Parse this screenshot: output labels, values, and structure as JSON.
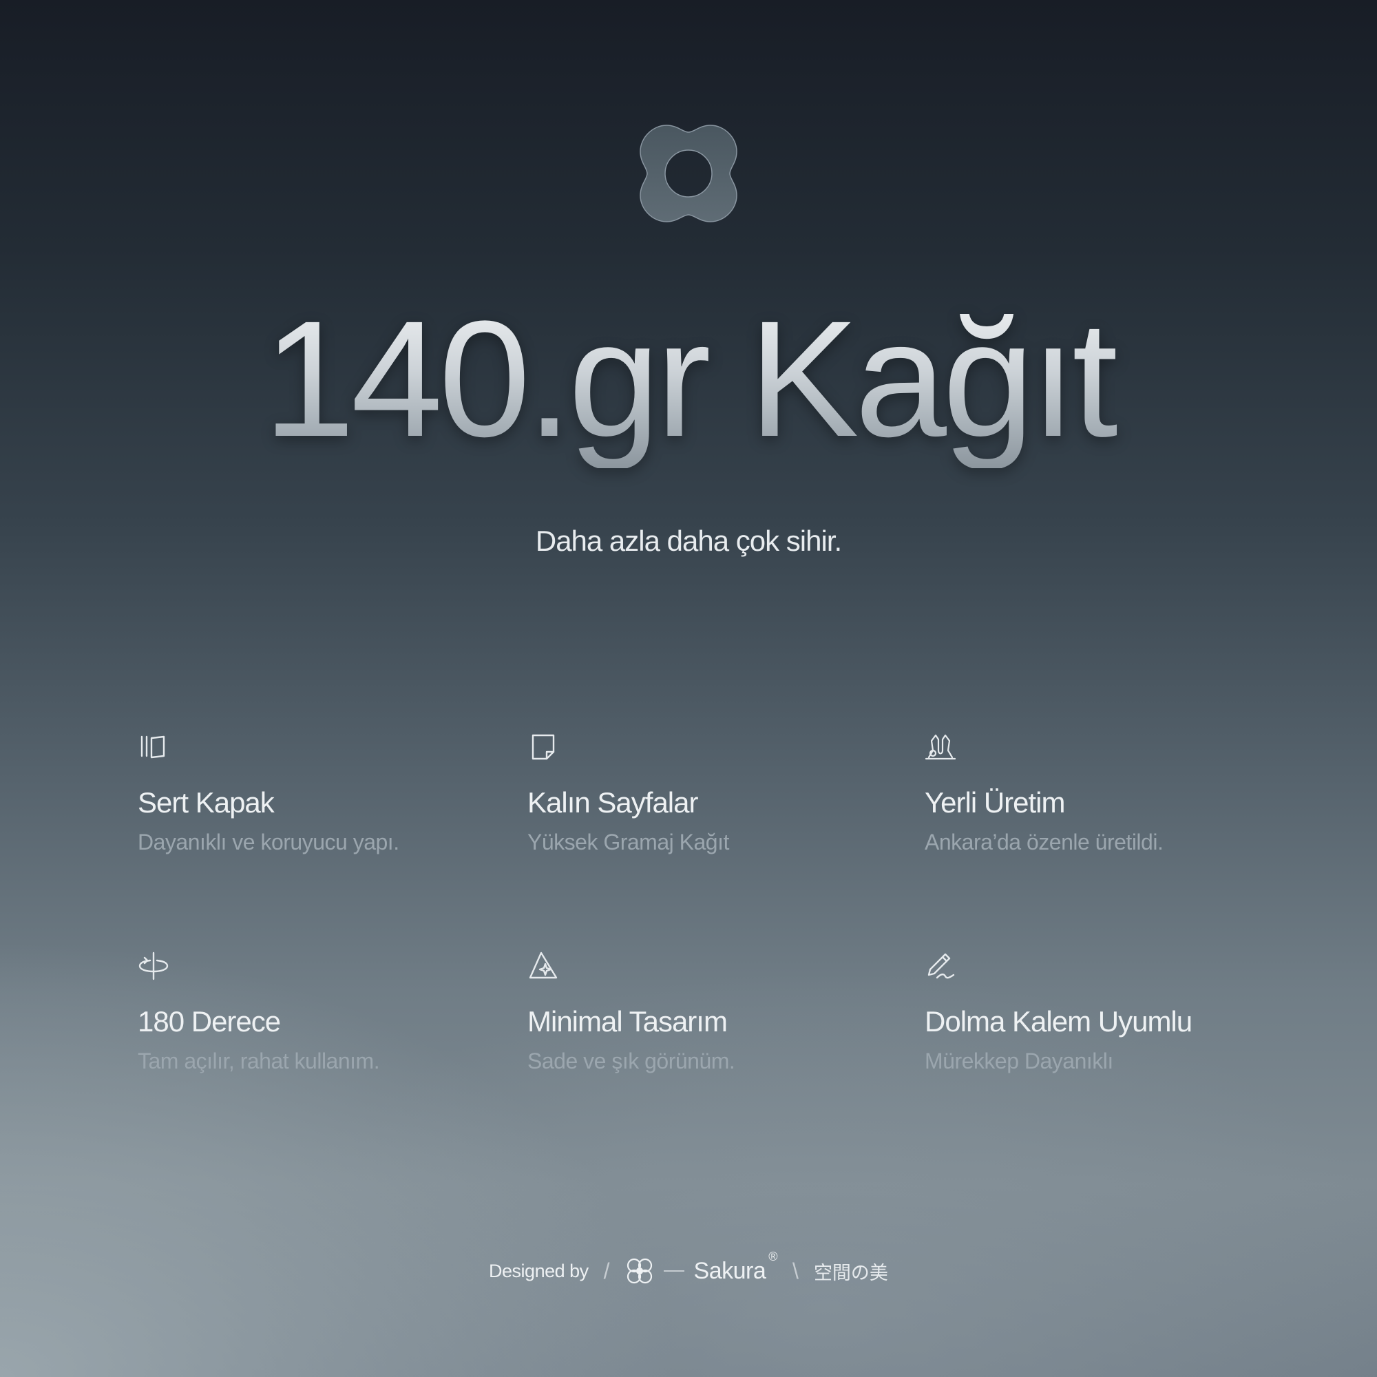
{
  "hero": {
    "logo_icon": "sakura-glass-logo-icon",
    "headline": "140.gr Kağıt",
    "tagline": "Daha azla daha çok sihir."
  },
  "features": [
    {
      "icon": "book-cover-icon",
      "title": "Sert Kapak",
      "description": "Dayanıklı ve koruyucu yapı."
    },
    {
      "icon": "page-icon",
      "title": "Kalın Sayfalar",
      "description": "Yüksek Gramaj Kağıt"
    },
    {
      "icon": "hands-icon",
      "title": "Yerli Üretim",
      "description": "Ankara’da özenle üretildi."
    },
    {
      "icon": "rotate-180-icon",
      "title": "180 Derece",
      "description": "Tam açılır, rahat kullanım."
    },
    {
      "icon": "sparkle-shape-icon",
      "title": "Minimal Tasarım",
      "description": "Sade ve şık görünüm."
    },
    {
      "icon": "pen-icon",
      "title": "Dolma Kalem Uyumlu",
      "description": "Mürekkep Dayanıklı"
    }
  ],
  "footer": {
    "designed_by": "Designed by",
    "separator_left": "/",
    "separator_right": "\\",
    "brand_icon": "sakura-flower-icon",
    "brand": "Sakura",
    "registered": "®",
    "japanese": "空間の美"
  },
  "colors": {
    "background_top": "#181d26",
    "background_bottom": "#7f8b93",
    "text_primary": "#eef1f3",
    "text_secondary": "#9ba6ae"
  }
}
